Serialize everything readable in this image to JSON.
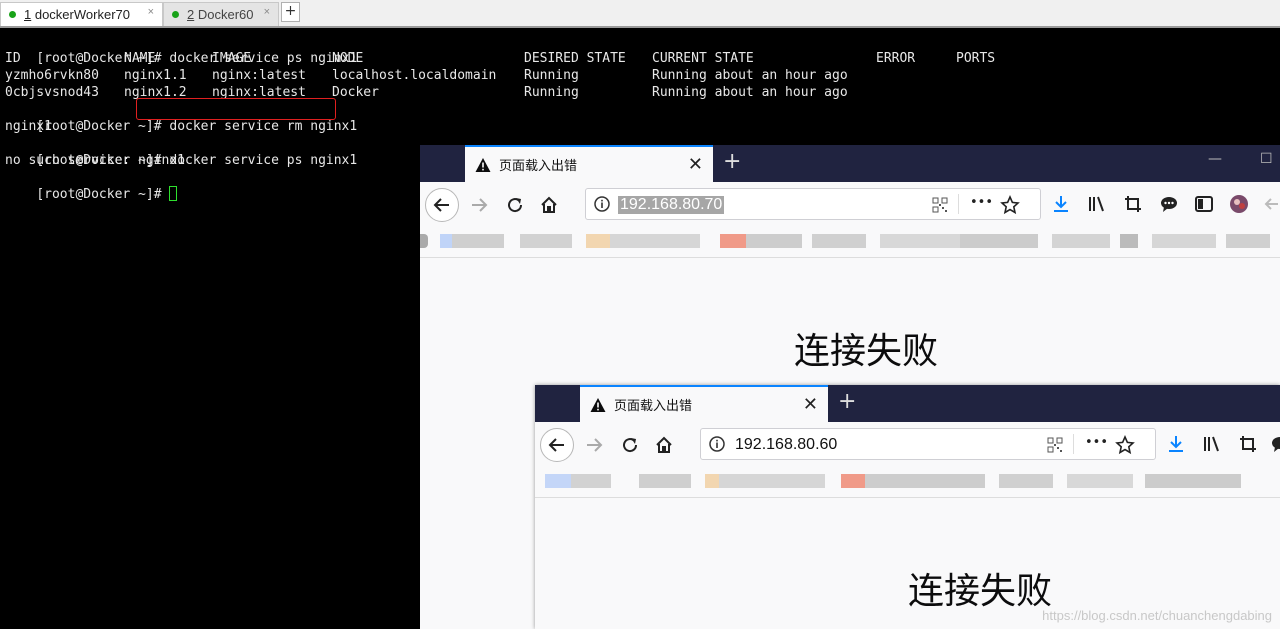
{
  "terminal_tabs": [
    {
      "number": "1",
      "label": " dockerWorker70",
      "close": "×"
    },
    {
      "number": "2",
      "label": " Docker60",
      "close": "×"
    }
  ],
  "terminal_add": "+",
  "terminal": {
    "lines": [
      {
        "prompt": "[root@Docker ~]# ",
        "command": "docker service ps nginx1"
      },
      {
        "header": [
          "ID",
          "NAME",
          "IMAGE",
          "NODE",
          "DESIRED STATE",
          "CURRENT STATE",
          "ERROR",
          "PORTS"
        ]
      },
      {
        "row": [
          "yzmho6rvkn80",
          "nginx1.1",
          "nginx:latest",
          "localhost.localdomain",
          "Running",
          "Running about an hour ago"
        ]
      },
      {
        "row": [
          "0cbjsvsnod43",
          "nginx1.2",
          "nginx:latest",
          "Docker",
          "Running",
          "Running about an hour ago"
        ]
      },
      {
        "prompt": "[root@Docker ~]# ",
        "command": "docker service rm nginx1"
      },
      {
        "output": "nginx1"
      },
      {
        "prompt": "[root@Docker ~]# ",
        "command": "docker service ps nginx1"
      },
      {
        "output": "no such service: nginx1"
      },
      {
        "prompt": "[root@Docker ~]# ",
        "command": ""
      }
    ]
  },
  "browser1": {
    "tab_title": "页面载入出错",
    "tab_close": "✕",
    "new_tab": "+",
    "minimize": "—",
    "maximize": "☐",
    "url": "192.168.80.70",
    "menu_dots": "•••",
    "error_title": "连接失败"
  },
  "browser2": {
    "tab_title": "页面载入出错",
    "tab_close": "✕",
    "new_tab": "+",
    "url": "192.168.80.60",
    "menu_dots": "•••",
    "error_title": "连接失败"
  },
  "watermark": "https://blog.csdn.net/chuanchengdabing",
  "colors": {
    "tab_strip": "#202340",
    "accent": "#0a84ff",
    "download": "#0a84ff",
    "highlight_box": "#e02020",
    "cursor": "#2ee02e",
    "active_dot": "#19a319"
  }
}
